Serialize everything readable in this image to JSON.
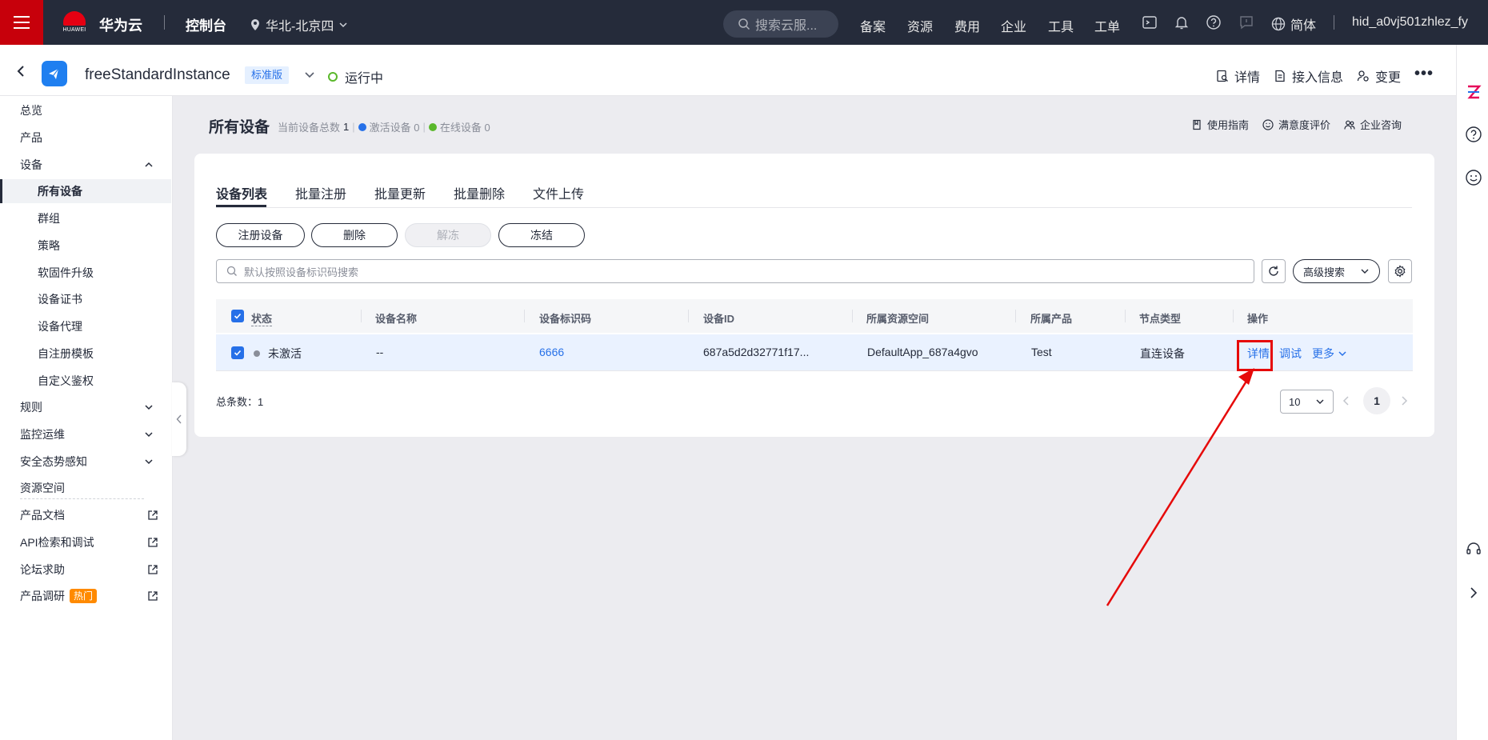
{
  "topbar": {
    "logo_text": "HUAWEI",
    "brand": "华为云",
    "console": "控制台",
    "region": "华北-北京四",
    "search_placeholder": "搜索云服...",
    "nav": [
      "备案",
      "资源",
      "费用",
      "企业",
      "工具",
      "工单"
    ],
    "lang": "简体",
    "user": "hid_a0vj501zhlez_fy"
  },
  "instance": {
    "name": "freeStandardInstance",
    "edition": "标准版",
    "status": "运行中",
    "actions": [
      "详情",
      "接入信息",
      "变更"
    ]
  },
  "sidebar": {
    "items": [
      {
        "label": "总览"
      },
      {
        "label": "产品"
      },
      {
        "label": "设备"
      },
      {
        "label": "所有设备"
      },
      {
        "label": "群组"
      },
      {
        "label": "策略"
      },
      {
        "label": "软固件升级"
      },
      {
        "label": "设备证书"
      },
      {
        "label": "设备代理"
      },
      {
        "label": "自注册模板"
      },
      {
        "label": "自定义鉴权"
      },
      {
        "label": "规则"
      },
      {
        "label": "监控运维"
      },
      {
        "label": "安全态势感知"
      },
      {
        "label": "资源空间"
      },
      {
        "label": "产品文档"
      },
      {
        "label": "API检索和调试"
      },
      {
        "label": "论坛求助"
      },
      {
        "label": "产品调研"
      }
    ],
    "hot_badge": "热门"
  },
  "page": {
    "title": "所有设备",
    "total_label": "当前设备总数",
    "total_value": "1",
    "active_label": "激活设备 0",
    "online_label": "在线设备 0",
    "links": [
      "使用指南",
      "满意度评价",
      "企业咨询"
    ]
  },
  "tabs": [
    "设备列表",
    "批量注册",
    "批量更新",
    "批量删除",
    "文件上传"
  ],
  "buttons": {
    "register": "注册设备",
    "delete": "删除",
    "unfreeze": "解冻",
    "freeze": "冻结"
  },
  "search": {
    "placeholder": "默认按照设备标识码搜索",
    "advanced": "高级搜索"
  },
  "table": {
    "headers": [
      "状态",
      "设备名称",
      "设备标识码",
      "设备ID",
      "所属资源空间",
      "所属产品",
      "节点类型",
      "操作"
    ],
    "rows": [
      {
        "status": "未激活",
        "name": "--",
        "identifier": "6666",
        "device_id": "687a5d2d32771f17...",
        "space": "DefaultApp_687a4gvo",
        "product": "Test",
        "node_type": "直连设备",
        "ops": [
          "详情",
          "调试",
          "更多"
        ]
      }
    ]
  },
  "pagination": {
    "total_label": "总条数：",
    "total": "1",
    "page_size": "10",
    "current_page": "1"
  },
  "colors": {
    "topbar": "#252b3a",
    "accent_red": "#c7000b",
    "link_blue": "#2670e8",
    "status_green": "#5ab82b",
    "annotation_red": "#e60a0a"
  }
}
